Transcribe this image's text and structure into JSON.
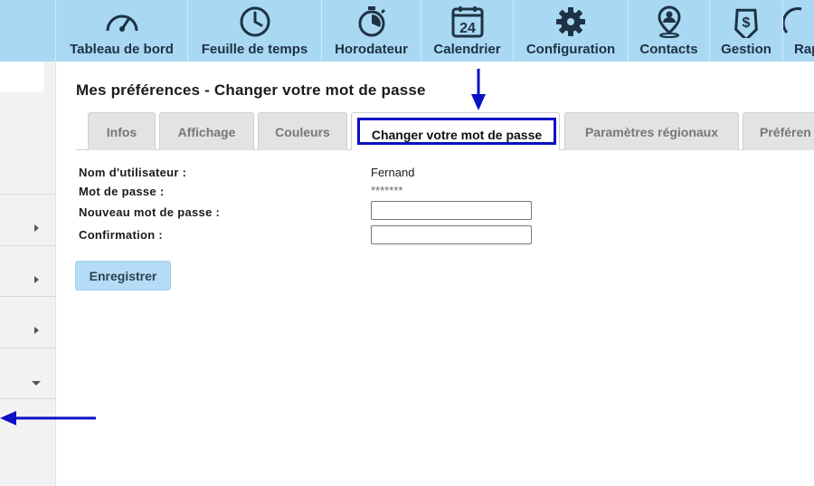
{
  "nav": {
    "items": [
      {
        "label": "Tableau de bord",
        "icon": "gauge-icon"
      },
      {
        "label": "Feuille de temps",
        "icon": "clock-icon"
      },
      {
        "label": "Horodateur",
        "icon": "stopwatch-icon"
      },
      {
        "label": "Calendrier",
        "icon": "calendar-icon",
        "calendar_day": "24"
      },
      {
        "label": "Configuration",
        "icon": "gear-icon"
      },
      {
        "label": "Contacts",
        "icon": "contact-pin-icon"
      },
      {
        "label": "Gestion",
        "icon": "dollar-tag-icon"
      },
      {
        "label": "Rap",
        "icon": "report-icon"
      }
    ]
  },
  "page": {
    "title": "Mes préférences - Changer votre mot de passe"
  },
  "tabs": [
    {
      "label": "Infos"
    },
    {
      "label": "Affichage"
    },
    {
      "label": "Couleurs"
    },
    {
      "label": "Changer votre mot de passe",
      "active": true
    },
    {
      "label": "Paramètres régionaux"
    },
    {
      "label": "Préféren"
    }
  ],
  "form": {
    "username_label": "Nom d'utilisateur :",
    "username_value": "Fernand",
    "password_label": "Mot de passe :",
    "password_value": "*******",
    "new_password_label": "Nouveau mot de passe :",
    "new_password_value": "",
    "confirm_label": "Confirmation :",
    "confirm_value": "",
    "save_label": "Enregistrer"
  },
  "colors": {
    "nav_bg": "#a9d8f3",
    "highlight": "#0a10c4",
    "save_bg": "#b4dcf6"
  }
}
